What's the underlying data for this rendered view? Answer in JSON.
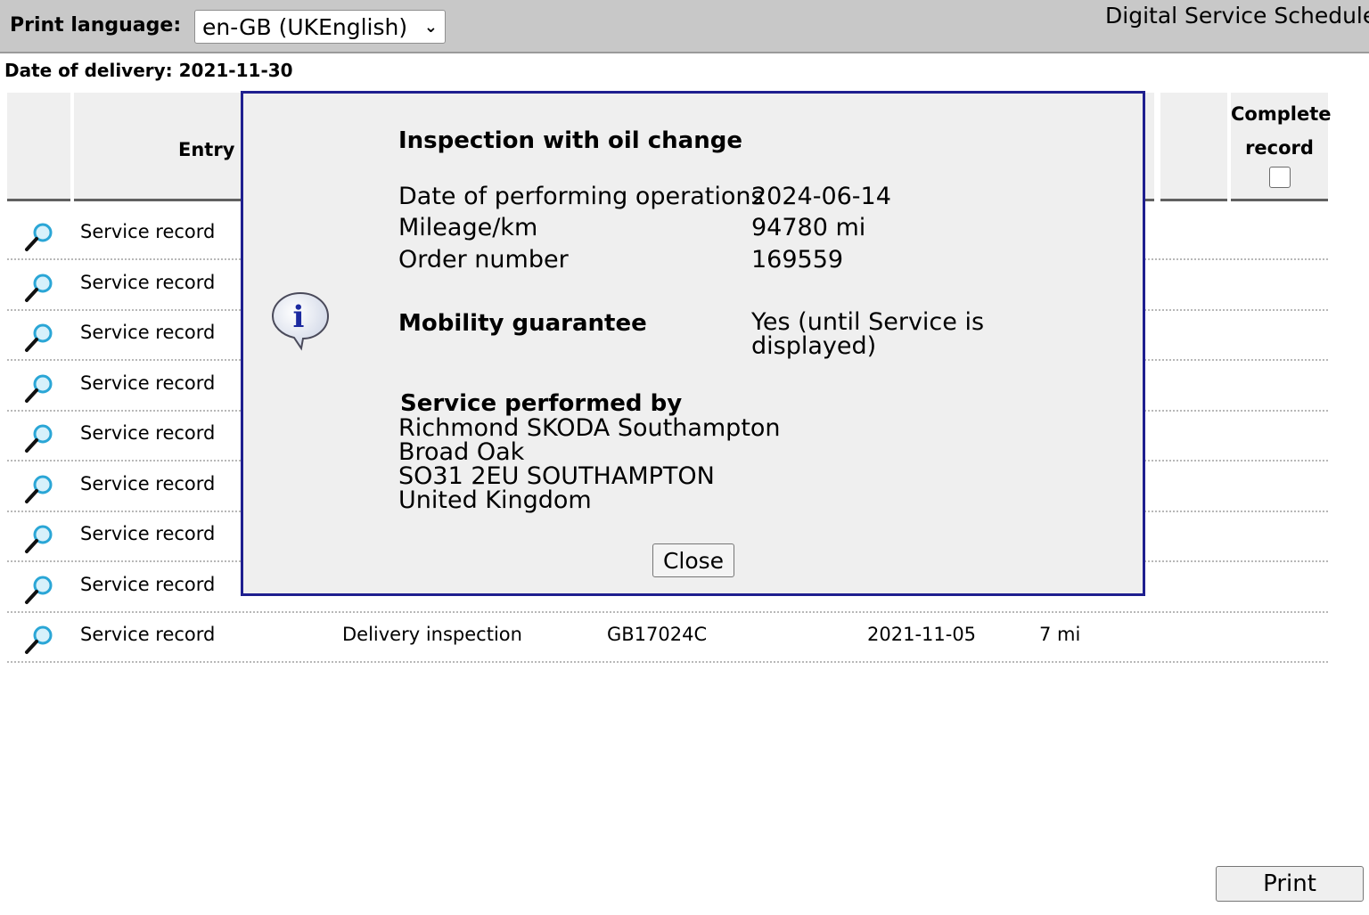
{
  "header": {
    "print_language_label": "Print language:",
    "print_language_value": "en-GB (UKEnglish)",
    "app_title": "Digital Service Schedule"
  },
  "delivery": {
    "text": "Date of delivery: 2021-11-30"
  },
  "table": {
    "entry_header": "Entry",
    "complete_header_line1": "Complete",
    "complete_header_line2": "record",
    "rows": [
      {
        "entry": "Service record",
        "type": "",
        "order": "",
        "date": "",
        "mileage": ""
      },
      {
        "entry": "Service record",
        "type": "",
        "order": "",
        "date": "",
        "mileage": ""
      },
      {
        "entry": "Service record",
        "type": "",
        "order": "",
        "date": "",
        "mileage": ""
      },
      {
        "entry": "Service record",
        "type": "",
        "order": "",
        "date": "",
        "mileage": ""
      },
      {
        "entry": "Service record",
        "type": "",
        "order": "",
        "date": "",
        "mileage": ""
      },
      {
        "entry": "Service record",
        "type": "",
        "order": "",
        "date": "",
        "mileage": ""
      },
      {
        "entry": "Service record",
        "type": "",
        "order": "",
        "date": "",
        "mileage": ""
      },
      {
        "entry": "Service record",
        "type": "",
        "order": "",
        "date": "",
        "mileage": ""
      },
      {
        "entry": "Service record",
        "type": "Delivery inspection",
        "order": "GB17024C",
        "date": "2021-11-05",
        "mileage": "7 mi"
      }
    ]
  },
  "modal": {
    "title": "Inspection with oil change",
    "date_label": "Date of performing operations",
    "date_value": "2024-06-14",
    "mileage_label": "Mileage/km",
    "mileage_value": "94780 mi",
    "order_label": "Order number",
    "order_value": "169559",
    "mobility_label": "Mobility guarantee",
    "mobility_value_line1": "Yes (until Service is",
    "mobility_value_line2": "displayed)",
    "service_by_label": "Service performed by",
    "service_by_lines": [
      "Richmond SKODA Southampton",
      "Broad Oak",
      "SO31 2EU SOUTHAMPTON",
      "United Kingdom"
    ],
    "close_label": "Close"
  },
  "footer": {
    "print_label": "Print"
  },
  "colors": {
    "modal_border": "#1f1f8f",
    "topbar": "#c8c8c8",
    "icon_accent": "#2aa6d6"
  }
}
